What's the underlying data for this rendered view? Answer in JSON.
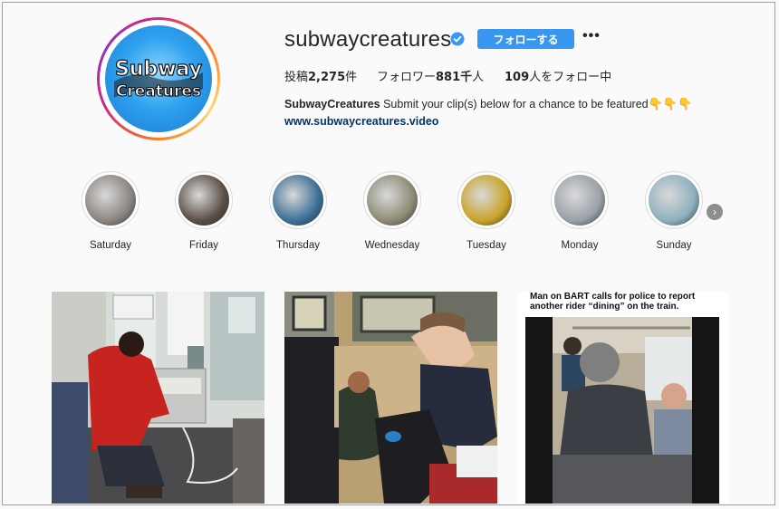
{
  "profile": {
    "username": "subwaycreatures",
    "follow_label": "フォローする",
    "more_label": "•••",
    "avatar_text_1": "Subway",
    "avatar_text_2": "Creatures"
  },
  "stats": {
    "posts_label": "投稿",
    "posts_value": "2,275",
    "posts_unit": "件",
    "followers_label": "フォロワー",
    "followers_value": "881千",
    "followers_unit": "人",
    "following_value": "109",
    "following_label": "人をフォロー中"
  },
  "bio": {
    "name": "SubwayCreatures",
    "text": "Submit your clip(s) below for a chance to be featured",
    "emoji": "👇👇👇",
    "link": "www.subwaycreatures.video"
  },
  "highlights": [
    {
      "label": "Saturday",
      "color": "#8a8580"
    },
    {
      "label": "Friday",
      "color": "#5a4e44"
    },
    {
      "label": "Thursday",
      "color": "#3b6f96"
    },
    {
      "label": "Wednesday",
      "color": "#8d8b74"
    },
    {
      "label": "Tuesday",
      "color": "#c9a32a"
    },
    {
      "label": "Monday",
      "color": "#9aa0a8"
    },
    {
      "label": "Sunday",
      "color": "#8db0bd"
    }
  ],
  "posts": {
    "third_caption": "Man on BART calls for police to report another rider “dining” on the train."
  },
  "colors": {
    "accent": "#3897f0",
    "link": "#003569"
  }
}
